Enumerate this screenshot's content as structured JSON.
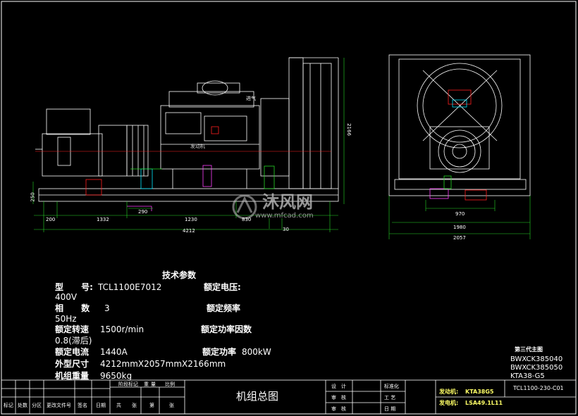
{
  "drawing": {
    "side_view_dimensions": [
      "200",
      "1332",
      "290",
      "1230",
      "830",
      "4212",
      "30",
      "250",
      "2166"
    ],
    "front_view_dimensions": [
      "970",
      "1980",
      "2057"
    ],
    "callout": "进气",
    "engine_label": "发动机"
  },
  "tech_params": {
    "title": "技术参数",
    "rows": [
      {
        "label": "型      号:",
        "value": "TCL1100E7012",
        "label2": "额定电压:",
        "value2": "400V"
      },
      {
        "label": "相      数",
        "value": "3",
        "label2": "额定频率",
        "value2": "50Hz"
      },
      {
        "label": "额定转速",
        "value": "1500r/min",
        "label2": "额定功率因数",
        "value2": "0.8(滞后)"
      },
      {
        "label": "额定电流",
        "value": "1440A",
        "label2": "额定功率",
        "value2": "800kW"
      },
      {
        "label": "外型尺寸",
        "value": "4212mmX2057mmX2166mm"
      },
      {
        "label": "机组重量",
        "value": "9650kg"
      }
    ]
  },
  "side_note": {
    "title": "第三代主图",
    "lines": [
      "BWXCK385040",
      "BWXCK385050",
      "KTA38-G5"
    ]
  },
  "watermark": {
    "brand": "沐风网",
    "url": "www.mfcad.com"
  },
  "title_block": {
    "drawing_title": "机组总图",
    "drawing_number": "TCL1100-230-C01",
    "engine_label": "发动机:",
    "engine_value": "KTA38G5",
    "alternator_label": "发电机:",
    "alternator_value": "LSA49.1L11",
    "bottom_headers": [
      "标记",
      "处数",
      "分区",
      "更改文件号",
      "签名",
      "日期",
      "标",
      "",
      "记",
      "重量",
      "比例"
    ],
    "stage_headers": [
      "阶段标记",
      "重",
      "量",
      "比例"
    ],
    "bottom_row2": [
      "共",
      "张",
      "第",
      "张"
    ],
    "sign_labels": [
      "设",
      "计",
      "审",
      "核",
      "审",
      "核"
    ],
    "right_labels": [
      "标准化",
      "工  艺",
      "日  期"
    ]
  },
  "colors": {
    "line": "#ffffff",
    "red": "#ff2020",
    "cyan": "#00e5ff",
    "green": "#26d826",
    "magenta": "#ff40ff",
    "yellow": "#ffff40"
  }
}
